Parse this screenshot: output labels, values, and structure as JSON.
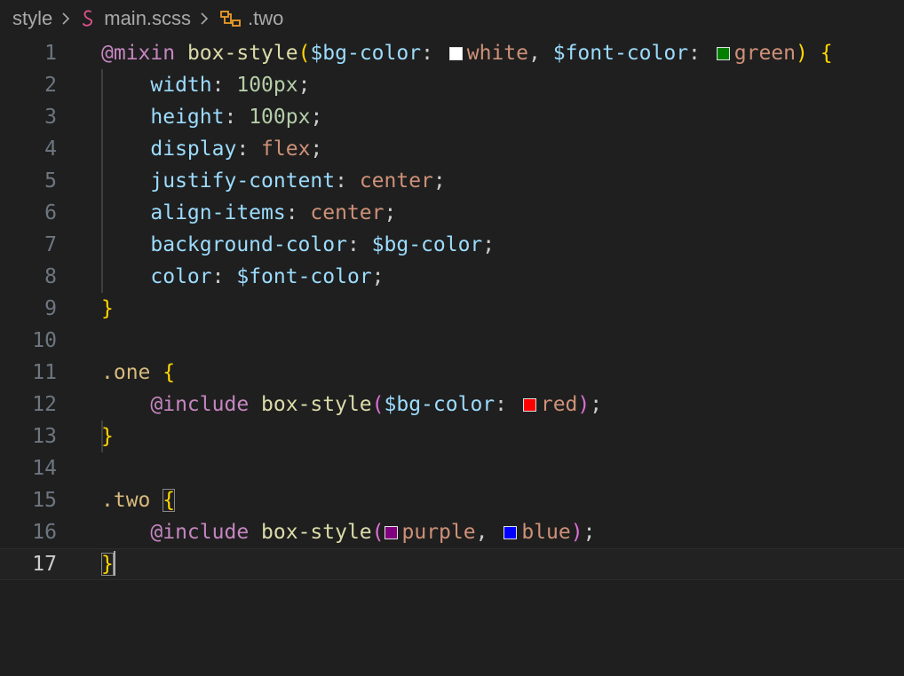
{
  "breadcrumbs": {
    "root": "style",
    "file": "main.scss",
    "symbol": ".two"
  },
  "editor": {
    "current_line": 17,
    "line_numbers": [
      "1",
      "2",
      "3",
      "4",
      "5",
      "6",
      "7",
      "8",
      "9",
      "10",
      "11",
      "12",
      "13",
      "14",
      "15",
      "16",
      "17"
    ],
    "lines": {
      "l1": {
        "at_mixin": "@mixin",
        "name": "box-style",
        "open_paren": "(",
        "param1": "$bg-color",
        "colon1": ": ",
        "value1": "white",
        "comma": ", ",
        "param2": "$font-color",
        "colon2": ": ",
        "value2": "green",
        "close_paren": ")",
        "open_brace": "{"
      },
      "l2": {
        "prop": "width",
        "colon": ": ",
        "value": "100px",
        "semi": ";"
      },
      "l3": {
        "prop": "height",
        "colon": ": ",
        "value": "100px",
        "semi": ";"
      },
      "l4": {
        "prop": "display",
        "colon": ": ",
        "value": "flex",
        "semi": ";"
      },
      "l5": {
        "prop": "justify-content",
        "colon": ": ",
        "value": "center",
        "semi": ";"
      },
      "l6": {
        "prop": "align-items",
        "colon": ": ",
        "value": "center",
        "semi": ";"
      },
      "l7": {
        "prop": "background-color",
        "colon": ": ",
        "value": "$bg-color",
        "semi": ";"
      },
      "l8": {
        "prop": "color",
        "colon": ": ",
        "value": "$font-color",
        "semi": ";"
      },
      "l9": {
        "close_brace": "}"
      },
      "l11": {
        "selector": ".one",
        "open_brace": "{"
      },
      "l12": {
        "include": "@include",
        "name": "box-style",
        "open_paren": "(",
        "param": "$bg-color",
        "colon": ": ",
        "value": "red",
        "close_paren": ")",
        "semi": ";"
      },
      "l13": {
        "close_brace": "}"
      },
      "l15": {
        "selector": ".two",
        "open_brace": "{"
      },
      "l16": {
        "include": "@include",
        "name": "box-style",
        "open_paren": "(",
        "value1": "purple",
        "comma": ", ",
        "value2": "blue",
        "close_paren": ")",
        "semi": ";"
      },
      "l17": {
        "close_brace": "}"
      }
    }
  },
  "colors": {
    "background": "#1f1f1f",
    "swatch_white": "#ffffff",
    "swatch_green": "#008000",
    "swatch_red": "#ff0000",
    "swatch_purple": "#800080",
    "swatch_blue": "#0000ff",
    "keyword": "#c586c0",
    "function": "#dcdcaa",
    "variable": "#9cdcfe",
    "number": "#b5cea8",
    "string": "#ce9178",
    "selector": "#d7ba7d",
    "bracket_level1": "#ffd700",
    "bracket_level2": "#da70d6"
  },
  "icons": {
    "file": "scss-file-icon",
    "symbol": "class-symbol-icon",
    "separator": "chevron-right-icon"
  }
}
